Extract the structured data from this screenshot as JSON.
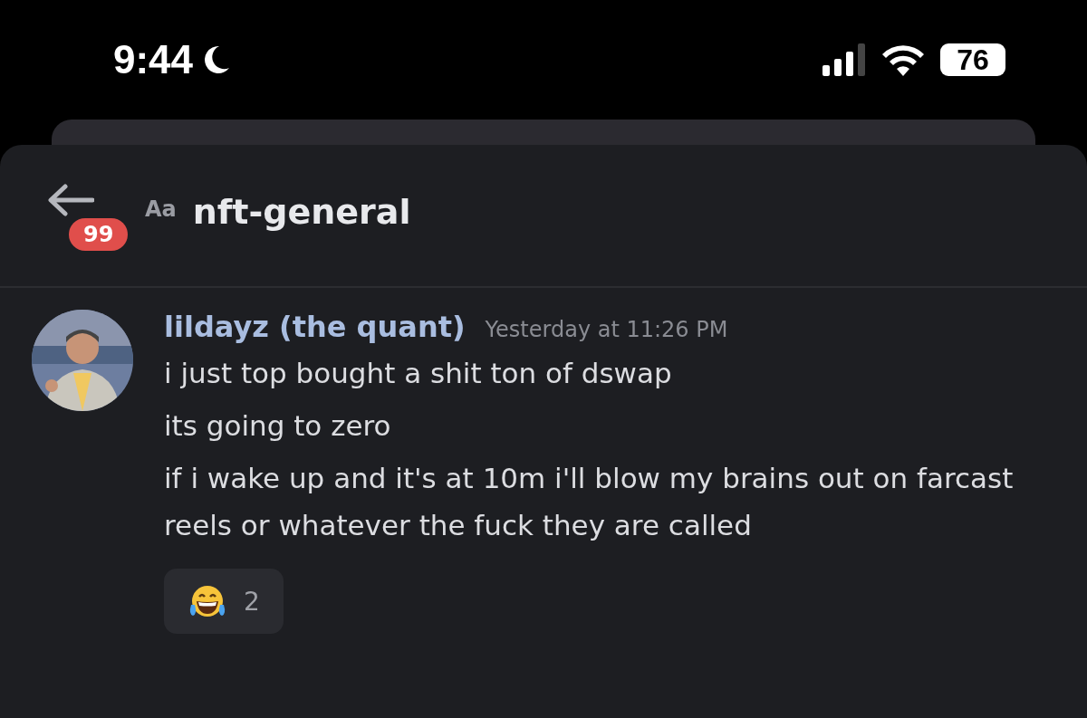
{
  "status_bar": {
    "time": "9:44",
    "battery": "76"
  },
  "header": {
    "unread_badge": "99",
    "font_toggle": "Aa",
    "channel": "nft-general"
  },
  "messages": [
    {
      "author": "lildayz (the quant)",
      "timestamp": "Yesterday at 11:26 PM",
      "lines": [
        "i just top bought a shit ton of dswap",
        "its going to zero",
        "if i wake up and it's at 10m i'll blow my brains out on farcast reels or whatever the fuck they are called"
      ],
      "reactions": [
        {
          "count": "2",
          "selected": false
        }
      ]
    }
  ]
}
